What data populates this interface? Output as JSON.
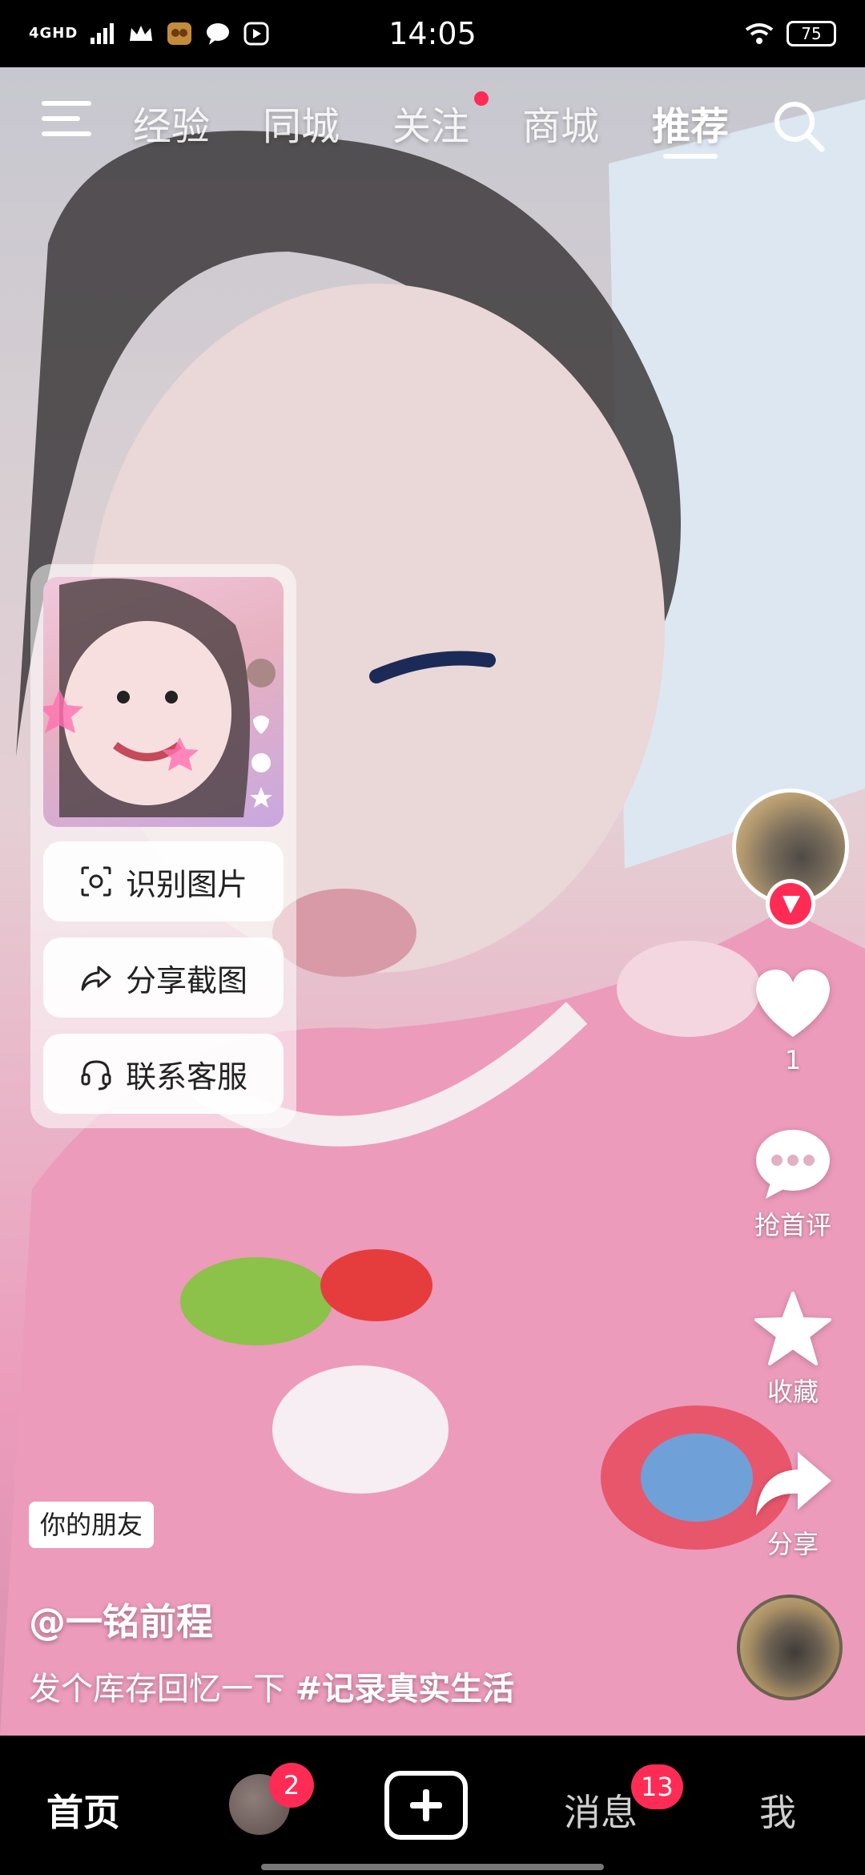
{
  "status_bar": {
    "network": "4GHD",
    "time": "14:05",
    "battery": "75",
    "icons": [
      "signal-icon",
      "crown-icon",
      "game-app-icon",
      "chat-icon",
      "play-icon",
      "wifi-icon"
    ]
  },
  "top_nav": {
    "tabs": [
      {
        "label": "经验"
      },
      {
        "label": "同城"
      },
      {
        "label": "关注"
      },
      {
        "label": "商城"
      },
      {
        "label": "推荐"
      }
    ],
    "active_tab": "推荐"
  },
  "long_press_menu": {
    "items": [
      {
        "label": "识别图片",
        "icon": "scan-image-icon"
      },
      {
        "label": "分享截图",
        "icon": "share-arrow-icon"
      },
      {
        "label": "联系客服",
        "icon": "headset-icon"
      }
    ]
  },
  "right_rail": {
    "like_count": "1",
    "comment_label": "抢首评",
    "favorite_label": "收藏",
    "share_label": "分享"
  },
  "caption": {
    "friend_tag": "你的朋友",
    "author": "@一铭前程",
    "text": "发个库存回忆一下 ",
    "hashtag": "#记录真实生活"
  },
  "bottom_nav": {
    "home": "首页",
    "friends_badge": "2",
    "messages": "消息",
    "messages_badge": "13",
    "me": "我"
  },
  "colors": {
    "accent": "#fe2c55",
    "shirt_pink": "#ec9bbb"
  }
}
